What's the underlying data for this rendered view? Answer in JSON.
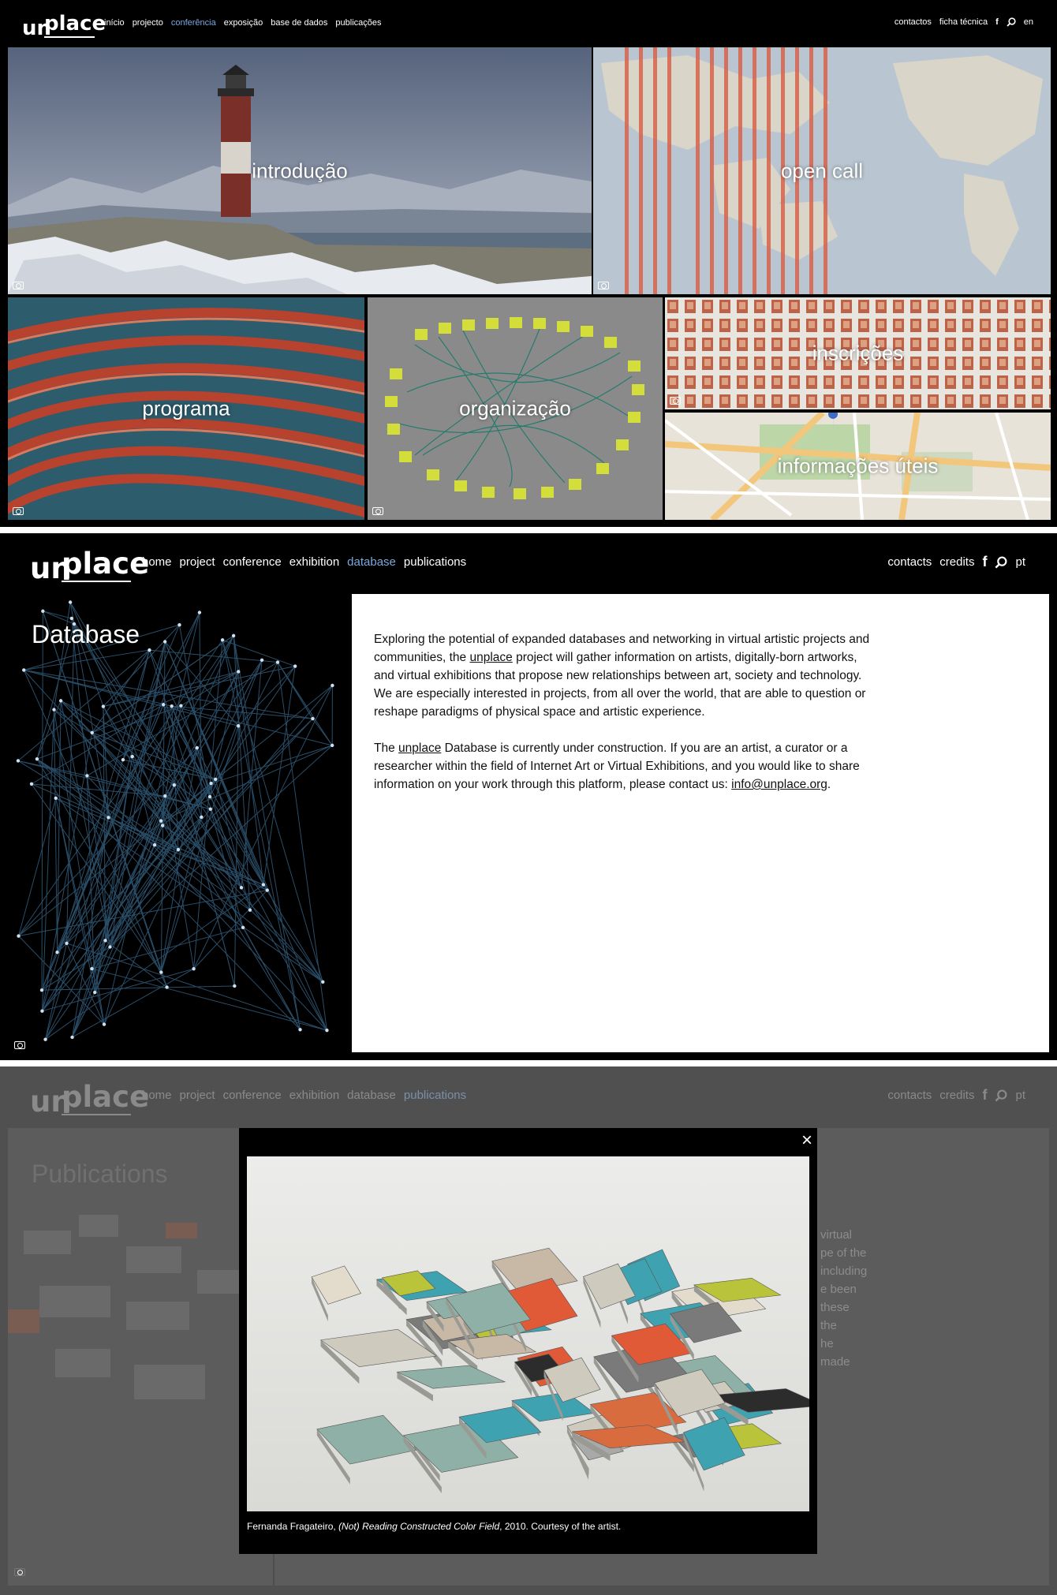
{
  "panel1": {
    "logo": {
      "un": "un",
      "place": "place"
    },
    "menu": [
      "início",
      "projecto",
      "conferência",
      "exposição",
      "base de dados",
      "publicações"
    ],
    "active_index": 2,
    "right": {
      "contacts": "contactos",
      "credits": "ficha técnica",
      "facebook": "f",
      "lang": "en"
    },
    "tiles": {
      "intro": "introdução",
      "opencall": "open call",
      "programa": "programa",
      "organizacao": "organização",
      "inscricoes": "inscrições",
      "info": "informações úteis"
    }
  },
  "panel2": {
    "logo": {
      "un": "un",
      "place": "place"
    },
    "menu": [
      "home",
      "project",
      "conference",
      "exhibition",
      "database",
      "publications"
    ],
    "active_index": 4,
    "right": {
      "contacts": "contacts",
      "credits": "credits",
      "facebook": "f",
      "lang": "pt"
    },
    "title": "Database",
    "para1": {
      "a": "Exploring the potential of expanded databases and networking in virtual artistic projects and communities, the ",
      "link": "unplace",
      "b": " project will gather information on artists, digitally-born artworks, and virtual exhibitions that propose new relationships between art, society and technology. We are especially interested in projects, from all over the world, that are able to question or reshape paradigms of physical space and artistic experience."
    },
    "para2": {
      "a": "The ",
      "link": "unplace",
      "b": " Database is currently under construction. If you are an artist, a curator or a researcher within the field of Internet Art or Virtual Exhibitions, and you would like to share information on your work through this platform, please contact us: ",
      "email": "info@unplace.org",
      "end": "."
    }
  },
  "panel3": {
    "logo": {
      "un": "un",
      "place": "place"
    },
    "menu": [
      "home",
      "project",
      "conference",
      "exhibition",
      "database",
      "publications"
    ],
    "active_index": 5,
    "right": {
      "contacts": "contacts",
      "credits": "credits",
      "facebook": "f",
      "lang": "pt"
    },
    "title": "Publications",
    "bg_text": [
      "virtual",
      "pe of the",
      "including",
      "e been",
      "these",
      "the",
      "he",
      "made"
    ],
    "modal": {
      "close": "×",
      "caption_a": "Fernanda Fragateiro, ",
      "caption_title": "(Not) Reading Constructed Color Field",
      "caption_b": ", 2010. Courtesy of the artist."
    }
  }
}
